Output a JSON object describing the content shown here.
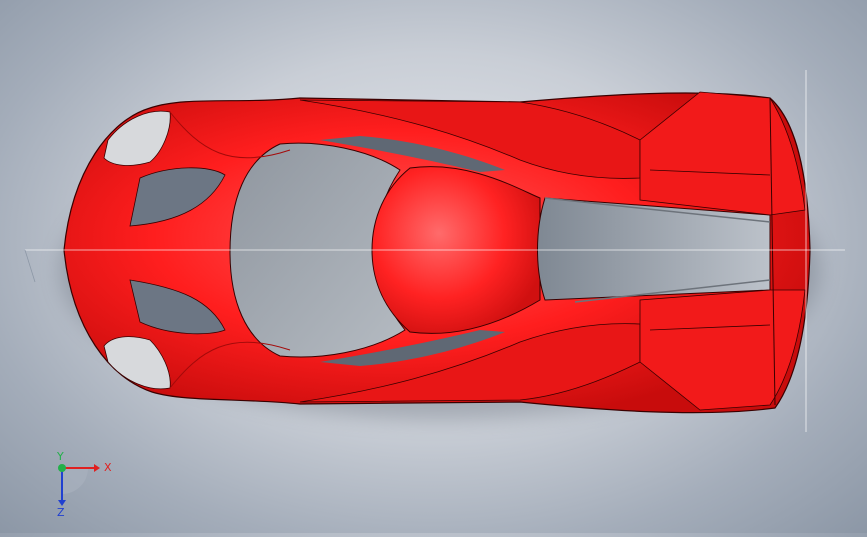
{
  "viewport": {
    "background_colors": [
      "#e6e9ee",
      "#8c97a6"
    ],
    "model_color": "#ff2020",
    "model_dark_color": "#c40e0e",
    "glass_color": "#6c7684",
    "opening_color": "#9aa1aa"
  },
  "triad": {
    "x_label": "X",
    "y_label": "Y",
    "z_label": "Z",
    "x_color": "#e02020",
    "y_color": "#22b04a",
    "z_color": "#2040d0"
  }
}
